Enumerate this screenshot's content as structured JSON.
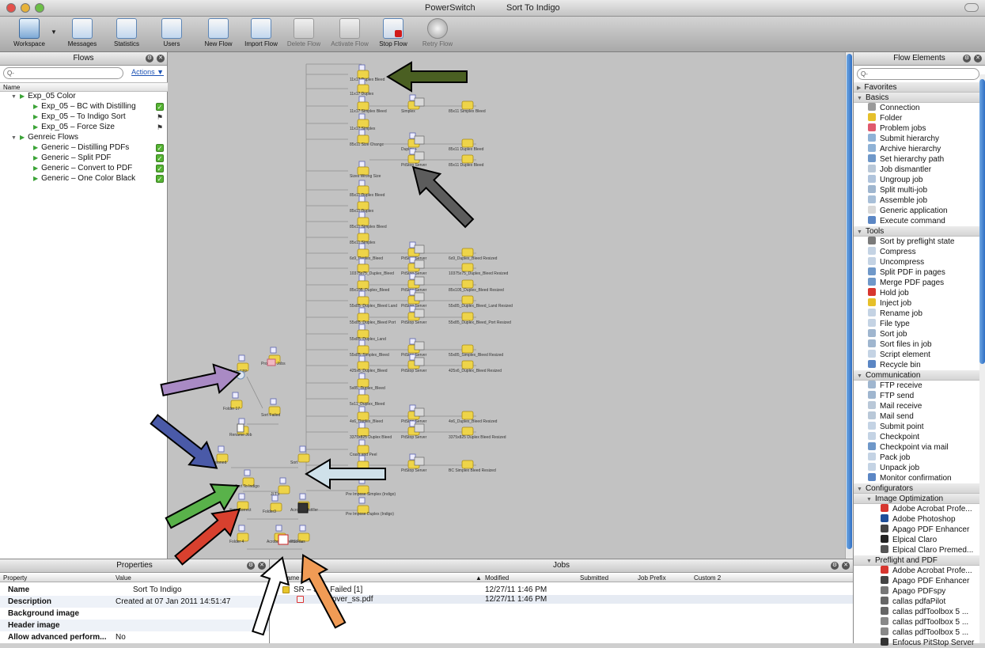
{
  "titlebar": {
    "app": "PowerSwitch",
    "flow": "Sort To Indigo"
  },
  "toolbar": {
    "buttons": [
      {
        "label": "Workspace",
        "icon": "workspace-icon",
        "enabled": true
      },
      {
        "label": "Messages",
        "icon": "messages-icon",
        "enabled": true
      },
      {
        "label": "Statistics",
        "icon": "statistics-icon",
        "enabled": true
      },
      {
        "label": "Users",
        "icon": "users-icon",
        "enabled": true
      },
      {
        "label": "New Flow",
        "icon": "new-flow-icon",
        "enabled": true
      },
      {
        "label": "Import Flow",
        "icon": "import-flow-icon",
        "enabled": true
      },
      {
        "label": "Delete Flow",
        "icon": "delete-flow-icon",
        "enabled": false
      },
      {
        "label": "Activate Flow",
        "icon": "activate-flow-icon",
        "enabled": false
      },
      {
        "label": "Stop Flow",
        "icon": "stop-flow-icon",
        "enabled": true
      },
      {
        "label": "Retry Flow",
        "icon": "retry-flow-icon",
        "enabled": false
      }
    ]
  },
  "flows_panel": {
    "title": "Flows",
    "search_placeholder": "Q-",
    "actions": "Actions ▼",
    "column": "Name",
    "items": [
      {
        "label": "Exp_05 Color",
        "group": true,
        "status": "none"
      },
      {
        "label": "Exp_05 – BC with Distilling",
        "group": false,
        "status": "active"
      },
      {
        "label": "Exp_05 – To Indigo Sort",
        "group": false,
        "status": "flag"
      },
      {
        "label": "Exp_05 – Force Size",
        "group": false,
        "status": "flag"
      },
      {
        "label": "Genreic Flows",
        "group": true,
        "status": "none"
      },
      {
        "label": "Generic – Distilling PDFs",
        "group": false,
        "status": "active"
      },
      {
        "label": "Generic – Split PDF",
        "group": false,
        "status": "active"
      },
      {
        "label": "Generic – Convert to PDF",
        "group": false,
        "status": "active"
      },
      {
        "label": "Generic – One Color Black",
        "group": false,
        "status": "active"
      }
    ]
  },
  "canvas": {
    "nodes": [
      "11x17 Duplex Bleed",
      "11x17 Duplex",
      "11x17 Simplex Bleed",
      "Simplex",
      "PitStop Server",
      "85x11 Simplex Bleed",
      "11x17 Simplex",
      "Duplex +",
      "85x11 Duplex Bleed",
      "85x11 Size Change",
      "Sizes Wrong Size",
      "85x11 Duplex Bleed",
      "85x11 Duplex Bleed",
      "85x11 Duplex",
      "85x11 Simplex Bleed",
      "85x11 Simplex",
      "6x9_Duplex_Bleed",
      "6x9_Duplex_Bleed Resized",
      "10375x75_Duplex_Bleed",
      "10375x75_Duplex_Bleed Resized",
      "85x105_Duplex_Bleed",
      "85x105_Duplex_Bleed Resized",
      "55x85_Duplex_Bleed Land",
      "55x85_Duplex_Bleed_Land Resized",
      "55x85_Duplex_Bleed Port",
      "55x85_Duplex_Bleed_Port Resized",
      "55x85_Duplex_Land",
      "55x85_Simplex_Bleed",
      "55x85_Simplex_Bleed Resized",
      "425x6_Duplex_Bleed",
      "425x6_Duplex_Bleed Resized",
      "5x85_Duplex_Bleed",
      "5x11_Duplex_Bleed",
      "4x6_Duplex_Bleed",
      "4x6_Duplex_Bleed Resized",
      "3375x825 Duplex Bleed",
      "3375x825 Duplex Bleed Resized",
      "Crash and Peel",
      "BC Simplex Bleed",
      "BC Simplex Bleed Resized",
      "Problem Jobs",
      "From FTP",
      "Folder 17",
      "Sort Failed",
      "Rename Job",
      "Versioned",
      "Sort",
      "Sort To Indigo",
      "JLT's",
      "Pre Impose Simplex (Indigo)",
      "Pre Impose Duplex (Indigo)",
      "Size Correct",
      "Folder3",
      "Acrobat Distiller",
      "Folder 4",
      "Acrobat Professional",
      "PS Files"
    ]
  },
  "elements_panel": {
    "title": "Flow Elements",
    "search_placeholder": "Q-",
    "items": [
      {
        "label": "Favorites",
        "kind": "cat"
      },
      {
        "label": "Basics",
        "kind": "cat"
      },
      {
        "label": "Connection",
        "kind": "item",
        "color": "#9a9a9a"
      },
      {
        "label": "Folder",
        "kind": "item",
        "color": "#e6c02b"
      },
      {
        "label": "Problem jobs",
        "kind": "item",
        "color": "#e05a6d"
      },
      {
        "label": "Submit hierarchy",
        "kind": "item",
        "color": "#8fb2d6"
      },
      {
        "label": "Archive hierarchy",
        "kind": "item",
        "color": "#8fb2d6"
      },
      {
        "label": "Set hierarchy path",
        "kind": "item",
        "color": "#6f98c9"
      },
      {
        "label": "Job dismantler",
        "kind": "item",
        "color": "#b9c8d8"
      },
      {
        "label": "Ungroup job",
        "kind": "item",
        "color": "#b0c4dc"
      },
      {
        "label": "Split multi-job",
        "kind": "item",
        "color": "#9fb6cf"
      },
      {
        "label": "Assemble job",
        "kind": "item",
        "color": "#a8bfd8"
      },
      {
        "label": "Generic application",
        "kind": "item",
        "color": "#d8d8d8"
      },
      {
        "label": "Execute command",
        "kind": "item",
        "color": "#5b86c4"
      },
      {
        "label": "Tools",
        "kind": "cat"
      },
      {
        "label": "Sort by preflight state",
        "kind": "item",
        "color": "#7a7a7a"
      },
      {
        "label": "Compress",
        "kind": "item",
        "color": "#c4d3e4"
      },
      {
        "label": "Uncompress",
        "kind": "item",
        "color": "#c4d3e4"
      },
      {
        "label": "Split PDF in pages",
        "kind": "item",
        "color": "#6f98c9"
      },
      {
        "label": "Merge PDF pages",
        "kind": "item",
        "color": "#6f98c9"
      },
      {
        "label": "Hold job",
        "kind": "item",
        "color": "#d7362f"
      },
      {
        "label": "Inject job",
        "kind": "item",
        "color": "#e6c02b"
      },
      {
        "label": "Rename job",
        "kind": "item",
        "color": "#c4d3e4"
      },
      {
        "label": "File type",
        "kind": "item",
        "color": "#c4d3e4"
      },
      {
        "label": "Sort job",
        "kind": "item",
        "color": "#9fb6cf"
      },
      {
        "label": "Sort files in job",
        "kind": "item",
        "color": "#9fb6cf"
      },
      {
        "label": "Script element",
        "kind": "item",
        "color": "#c4d3e4"
      },
      {
        "label": "Recycle bin",
        "kind": "item",
        "color": "#5b86c4"
      },
      {
        "label": "Communication",
        "kind": "cat"
      },
      {
        "label": "FTP receive",
        "kind": "item",
        "color": "#9fb6cf"
      },
      {
        "label": "FTP send",
        "kind": "item",
        "color": "#9fb6cf"
      },
      {
        "label": "Mail receive",
        "kind": "item",
        "color": "#b9c8d8"
      },
      {
        "label": "Mail send",
        "kind": "item",
        "color": "#b9c8d8"
      },
      {
        "label": "Submit point",
        "kind": "item",
        "color": "#c4d3e4"
      },
      {
        "label": "Checkpoint",
        "kind": "item",
        "color": "#c4d3e4"
      },
      {
        "label": "Checkpoint via mail",
        "kind": "item",
        "color": "#6f98c9"
      },
      {
        "label": "Pack job",
        "kind": "item",
        "color": "#c4d3e4"
      },
      {
        "label": "Unpack job",
        "kind": "item",
        "color": "#c4d3e4"
      },
      {
        "label": "Monitor confirmation",
        "kind": "item",
        "color": "#5b86c4"
      },
      {
        "label": "Configurators",
        "kind": "cat"
      },
      {
        "label": "Image Optimization",
        "kind": "subcat"
      },
      {
        "label": "Adobe Acrobat Profe...",
        "kind": "sub",
        "color": "#d7362f"
      },
      {
        "label": "Adobe Photoshop",
        "kind": "sub",
        "color": "#1f4f9a"
      },
      {
        "label": "Apago PDF Enhancer",
        "kind": "sub",
        "color": "#444444"
      },
      {
        "label": "Elpical Claro",
        "kind": "sub",
        "color": "#222222"
      },
      {
        "label": "Elpical Claro Premed...",
        "kind": "sub",
        "color": "#555555"
      },
      {
        "label": "Preflight and PDF",
        "kind": "subcat"
      },
      {
        "label": "Adobe Acrobat Profe...",
        "kind": "sub",
        "color": "#d7362f"
      },
      {
        "label": "Apago PDF Enhancer",
        "kind": "sub",
        "color": "#444444"
      },
      {
        "label": "Apago PDFspy",
        "kind": "sub",
        "color": "#777777"
      },
      {
        "label": "callas pdfaPilot",
        "kind": "sub",
        "color": "#666666"
      },
      {
        "label": "callas pdfToolbox 5 ...",
        "kind": "sub",
        "color": "#666666"
      },
      {
        "label": "callas pdfToolbox 5 ...",
        "kind": "sub",
        "color": "#888888"
      },
      {
        "label": "callas pdfToolbox 5 ...",
        "kind": "sub",
        "color": "#888888"
      },
      {
        "label": "Enfocus PitStop Server",
        "kind": "sub",
        "color": "#333333"
      }
    ]
  },
  "properties_panel": {
    "title": "Properties",
    "col_property": "Property",
    "col_value": "Value",
    "rows": [
      {
        "name": "Name",
        "value": "Sort To Indigo"
      },
      {
        "name": "Description",
        "value": "Created at 07 Jan 2011 14:51:47"
      },
      {
        "name": "Background image",
        "value": ""
      },
      {
        "name": "Header image",
        "value": ""
      },
      {
        "name": "Allow advanced perform...",
        "value": "No"
      }
    ]
  },
  "jobs_panel": {
    "title": "Jobs",
    "columns": [
      "Name",
      "Modified",
      "Submitted",
      "Job Prefix",
      "Custom 2"
    ],
    "rows": [
      {
        "name": "SR – Sort Failed [1]",
        "modified": "12/27/11 1:46 PM",
        "indent": false
      },
      {
        "name": "_Cover_ss.pdf",
        "modified": "12/27/11 1:46 PM",
        "indent": true
      }
    ]
  },
  "annotation_arrows": [
    {
      "color": "#4a5f22",
      "direction": "left"
    },
    {
      "color": "#5c5c5c",
      "direction": "up-left"
    },
    {
      "color": "#a98ac4",
      "direction": "right"
    },
    {
      "color": "#4a5aa8",
      "direction": "down-right"
    },
    {
      "color": "#cfe1ea",
      "direction": "left"
    },
    {
      "color": "#59b24a",
      "direction": "up-right"
    },
    {
      "color": "#d8402e",
      "direction": "up-right"
    },
    {
      "color": "#f09b55",
      "direction": "up-left"
    },
    {
      "color": "#ffffff",
      "direction": "up"
    }
  ]
}
